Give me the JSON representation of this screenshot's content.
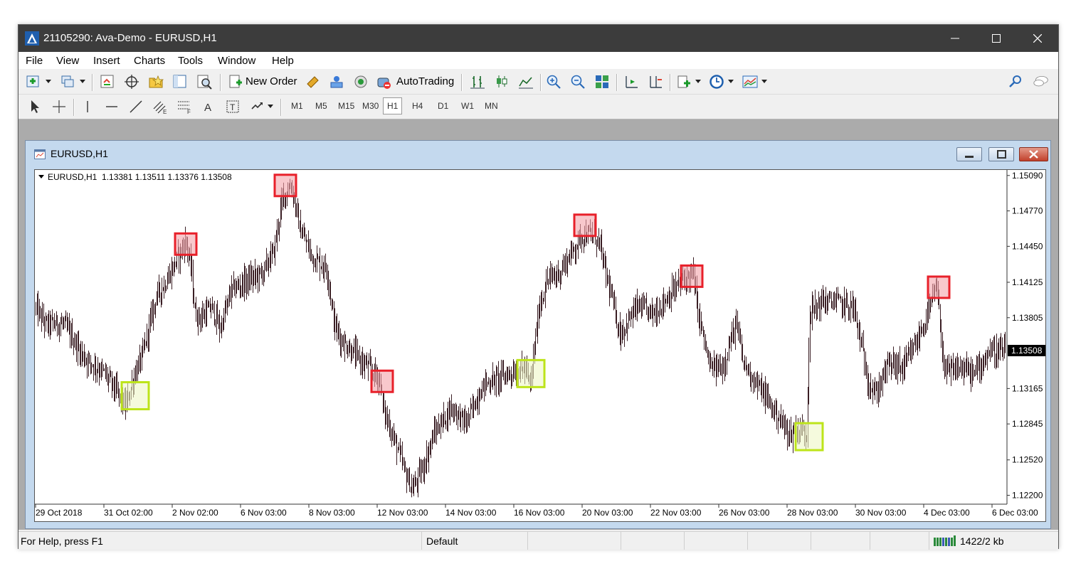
{
  "window": {
    "title": "21105290: Ava-Demo - EURUSD,H1",
    "minimize_icon": "minimize-icon",
    "maximize_icon": "maximize-icon",
    "close_icon": "close-icon"
  },
  "menu": [
    "File",
    "View",
    "Insert",
    "Charts",
    "Tools",
    "Window",
    "Help"
  ],
  "toolbar": {
    "new_order_label": "New Order",
    "autotrading_label": "AutoTrading"
  },
  "timeframes": [
    "M1",
    "M5",
    "M15",
    "M30",
    "H1",
    "H4",
    "D1",
    "W1",
    "MN"
  ],
  "active_timeframe": "H1",
  "chart_window": {
    "title": "EURUSD,H1",
    "header": "EURUSD,H1  1.13381 1.13511 1.13376 1.13508"
  },
  "chart_data": {
    "type": "bar",
    "symbol": "EURUSD",
    "timeframe": "H1",
    "ohlc": {
      "open": 1.13381,
      "high": 1.13511,
      "low": 1.13376,
      "close": 1.13508
    },
    "current_price": "1.13508",
    "y_ticks": [
      "1.15090",
      "1.14770",
      "1.14450",
      "1.14125",
      "1.13805",
      "1.13508",
      "1.13165",
      "1.12845",
      "1.12520",
      "1.12200"
    ],
    "x_ticks": [
      "29 Oct 2018",
      "31 Oct 02:00",
      "2 Nov 02:00",
      "6 Nov 03:00",
      "8 Nov 03:00",
      "12 Nov 03:00",
      "14 Nov 03:00",
      "16 Nov 03:00",
      "20 Nov 03:00",
      "22 Nov 03:00",
      "26 Nov 03:00",
      "28 Nov 03:00",
      "30 Nov 03:00",
      "4 Dec 03:00",
      "6 Dec 03:00"
    ],
    "ylim": [
      1.1212,
      1.1514
    ],
    "price_path": [
      [
        0,
        1.139
      ],
      [
        14,
        1.1375
      ],
      [
        40,
        1.1375
      ],
      [
        68,
        1.1345
      ],
      [
        98,
        1.133
      ],
      [
        118,
        1.131
      ],
      [
        127,
        1.13
      ],
      [
        140,
        1.133
      ],
      [
        150,
        1.1345
      ],
      [
        170,
        1.14
      ],
      [
        186,
        1.1415
      ],
      [
        200,
        1.1435
      ],
      [
        212,
        1.145
      ],
      [
        220,
        1.142
      ],
      [
        224,
        1.1385
      ],
      [
        232,
        1.138
      ],
      [
        248,
        1.139
      ],
      [
        260,
        1.137
      ],
      [
        275,
        1.1405
      ],
      [
        300,
        1.1415
      ],
      [
        318,
        1.142
      ],
      [
        335,
        1.144
      ],
      [
        348,
        1.149
      ],
      [
        360,
        1.15
      ],
      [
        372,
        1.146
      ],
      [
        390,
        1.1435
      ],
      [
        410,
        1.1425
      ],
      [
        420,
        1.1375
      ],
      [
        430,
        1.136
      ],
      [
        460,
        1.134
      ],
      [
        485,
        1.1325
      ],
      [
        488,
        1.13
      ],
      [
        510,
        1.126
      ],
      [
        520,
        1.124
      ],
      [
        530,
        1.1225
      ],
      [
        545,
        1.1245
      ],
      [
        560,
        1.1275
      ],
      [
        585,
        1.13
      ],
      [
        605,
        1.1285
      ],
      [
        630,
        1.132
      ],
      [
        665,
        1.133
      ],
      [
        690,
        1.1335
      ],
      [
        695,
        1.1315
      ],
      [
        708,
        1.139
      ],
      [
        720,
        1.1415
      ],
      [
        735,
        1.142
      ],
      [
        750,
        1.1435
      ],
      [
        768,
        1.1455
      ],
      [
        782,
        1.1455
      ],
      [
        792,
        1.145
      ],
      [
        800,
        1.1425
      ],
      [
        815,
        1.1385
      ],
      [
        822,
        1.1365
      ],
      [
        845,
        1.139
      ],
      [
        870,
        1.1385
      ],
      [
        890,
        1.14
      ],
      [
        910,
        1.1415
      ],
      [
        925,
        1.142
      ],
      [
        930,
        1.139
      ],
      [
        948,
        1.1335
      ],
      [
        965,
        1.1335
      ],
      [
        985,
        1.1375
      ],
      [
        995,
        1.134
      ],
      [
        1020,
        1.1315
      ],
      [
        1040,
        1.1295
      ],
      [
        1060,
        1.1275
      ],
      [
        1075,
        1.128
      ],
      [
        1084,
        1.1275
      ],
      [
        1088,
        1.1385
      ],
      [
        1105,
        1.1395
      ],
      [
        1125,
        1.1395
      ],
      [
        1150,
        1.139
      ],
      [
        1170,
        1.1325
      ],
      [
        1180,
        1.131
      ],
      [
        1200,
        1.134
      ],
      [
        1220,
        1.1335
      ],
      [
        1240,
        1.136
      ],
      [
        1258,
        1.139
      ],
      [
        1266,
        1.141
      ],
      [
        1278,
        1.133
      ],
      [
        1300,
        1.1335
      ],
      [
        1320,
        1.133
      ],
      [
        1340,
        1.135
      ],
      [
        1365,
        1.135
      ]
    ],
    "annotations": [
      {
        "kind": "high",
        "x": 212,
        "price": 1.1447,
        "color": "#e8202a",
        "fill": "#f4a3aa"
      },
      {
        "kind": "high",
        "x": 352,
        "price": 1.15,
        "color": "#e8202a",
        "fill": "#f4a3aa"
      },
      {
        "kind": "high",
        "x": 488,
        "price": 1.1323,
        "color": "#e8202a",
        "fill": "#f4a3aa"
      },
      {
        "kind": "high",
        "x": 773,
        "price": 1.1464,
        "color": "#e8202a",
        "fill": "#f4a3aa"
      },
      {
        "kind": "high",
        "x": 923,
        "price": 1.1418,
        "color": "#e8202a",
        "fill": "#f4a3aa"
      },
      {
        "kind": "high",
        "x": 1270,
        "price": 1.1408,
        "color": "#e8202a",
        "fill": "#f4a3aa"
      },
      {
        "kind": "low",
        "x": 141,
        "price": 1.131,
        "color": "#bde41a",
        "fill": "#eef7c6"
      },
      {
        "kind": "low",
        "x": 697,
        "price": 1.133,
        "color": "#bde41a",
        "fill": "#eef7c6"
      },
      {
        "kind": "low",
        "x": 1088,
        "price": 1.1273,
        "color": "#bde41a",
        "fill": "#eef7c6"
      }
    ],
    "bar_color": "#3a1e24",
    "grid": false
  },
  "status": {
    "help": "For Help, press F1",
    "profile": "Default",
    "traffic": "1422/2 kb"
  }
}
